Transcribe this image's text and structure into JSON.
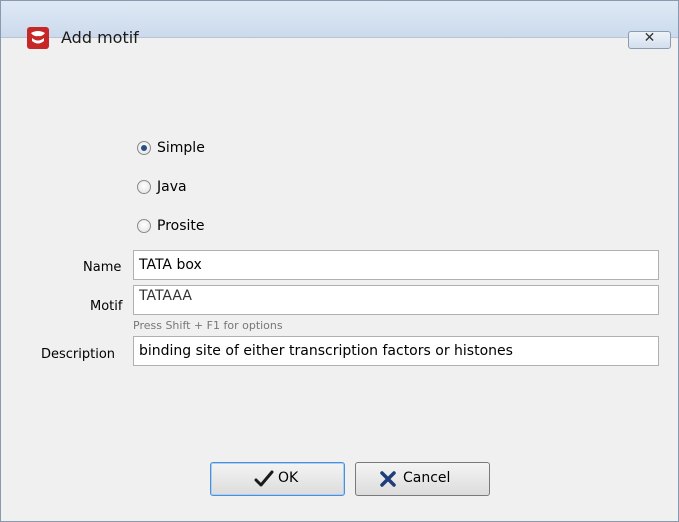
{
  "window": {
    "title": "Add motif",
    "close_glyph": "✕"
  },
  "motif_type": {
    "options": [
      {
        "label": "Simple",
        "checked": true
      },
      {
        "label": "Java",
        "checked": false
      },
      {
        "label": "Prosite",
        "checked": false
      }
    ]
  },
  "form": {
    "name_label": "Name",
    "name_value": "TATA box",
    "motif_label": "Motif",
    "motif_value": "TATAAA",
    "motif_hint": "Press Shift + F1 for options",
    "description_label": "Description",
    "description_value": "binding site of either transcription factors or histones"
  },
  "buttons": {
    "ok_label": "OK",
    "cancel_label": "Cancel"
  },
  "icons": {
    "app": "app-logo-icon",
    "ok": "checkmark-icon",
    "cancel": "cross-icon"
  },
  "colors": {
    "ok_border": "#4e8fd3",
    "radio_dot": "#2a4f86",
    "titlebar": "#dfe9f5"
  }
}
